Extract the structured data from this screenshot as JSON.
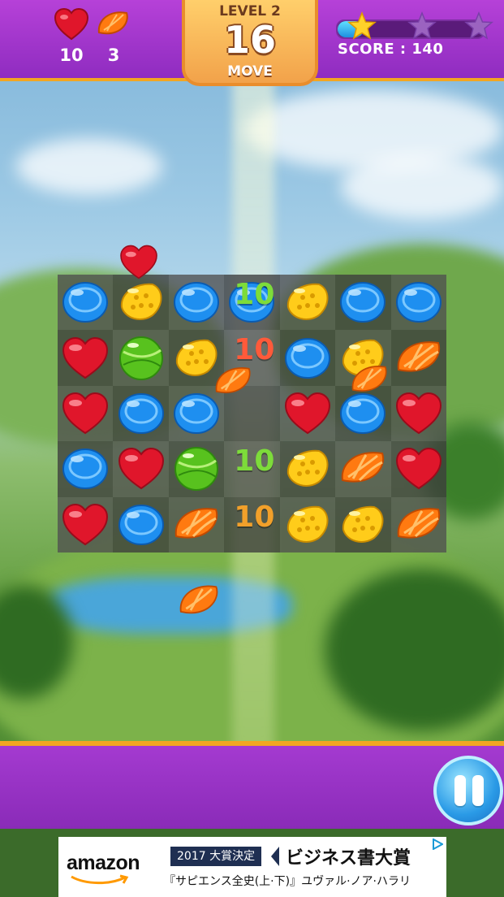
{
  "hud": {
    "hearts_goal": "10",
    "oranges_goal": "3",
    "level_label": "LEVEL 2",
    "moves_number": "16",
    "moves_label": "MOVE",
    "score_text": "SCORE : 140",
    "score_progress": 0.18,
    "stars_earned": 1,
    "stars_total": 3
  },
  "board": {
    "columns": 7,
    "rows": 5,
    "grid": [
      [
        "blue",
        "yellow",
        "blue",
        "blue",
        "yellow",
        "blue",
        "blue"
      ],
      [
        "heart",
        "green",
        "yellow",
        "empty",
        "blue",
        "yellow",
        "orange"
      ],
      [
        "heart",
        "blue",
        "blue",
        "empty",
        "heart",
        "blue",
        "heart"
      ],
      [
        "blue",
        "heart",
        "green",
        "empty",
        "yellow",
        "orange",
        "heart"
      ],
      [
        "heart",
        "blue",
        "orange",
        "empty",
        "yellow",
        "yellow",
        "orange"
      ]
    ],
    "score_popups": [
      {
        "text": "10",
        "color": "#7ddc3a",
        "row": 0,
        "col": 3
      },
      {
        "text": "10",
        "color": "#ff5a3a",
        "row": 1,
        "col": 3
      },
      {
        "text": "10",
        "color": "#7ddc3a",
        "row": 3,
        "col": 3
      },
      {
        "text": "10",
        "color": "#f2a02a",
        "row": 4,
        "col": 3
      }
    ]
  },
  "colors": {
    "bar_purple": "#9c33c8",
    "bar_border": "#f2a622",
    "heart_red": "#e0162b",
    "candy_blue": "#1e8ff0",
    "candy_yellow": "#ffcc1a",
    "candy_green": "#58c21e",
    "candy_orange": "#ff7a10"
  },
  "pause": {
    "label": "pause"
  },
  "ad": {
    "brand": "amazon",
    "badge": "2017 大賞決定",
    "title": "ビジネス書大賞",
    "subtitle": "『サピエンス全史(上·下)』ユヴァル·ノア·ハラリ"
  }
}
